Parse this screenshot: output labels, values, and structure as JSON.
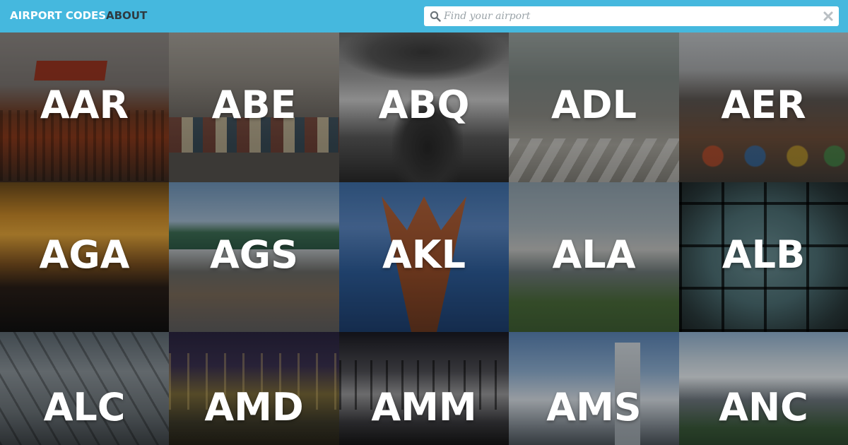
{
  "nav": {
    "brand": "AIRPORT CODES",
    "about": "ABOUT"
  },
  "search": {
    "placeholder": "Find your airport",
    "value": ""
  },
  "colors": {
    "topbar": "#45b8de",
    "brand_text": "#ffffff",
    "about_text": "#2f3a40"
  },
  "airports": [
    {
      "code": "AAR"
    },
    {
      "code": "ABE"
    },
    {
      "code": "ABQ"
    },
    {
      "code": "ADL"
    },
    {
      "code": "AER"
    },
    {
      "code": "AGA"
    },
    {
      "code": "AGS"
    },
    {
      "code": "AKL"
    },
    {
      "code": "ALA"
    },
    {
      "code": "ALB"
    },
    {
      "code": "ALC"
    },
    {
      "code": "AMD"
    },
    {
      "code": "AMM"
    },
    {
      "code": "AMS"
    },
    {
      "code": "ANC"
    }
  ]
}
